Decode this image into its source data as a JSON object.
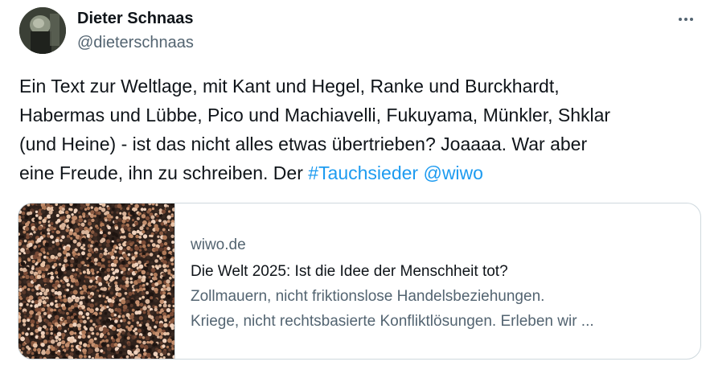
{
  "author": {
    "name": "Dieter Schnaas",
    "handle": "@dieterschnaas",
    "avatar_icon": "user-avatar"
  },
  "more_icon": "more-horizontal-icon",
  "tweet": {
    "line1": "Ein Text zur Weltlage, mit Kant und Hegel, Ranke und Burckhardt,",
    "line2": "Habermas und Lübbe, Pico und Machiavelli, Fukuyama, Münkler, Shklar",
    "line3": "(und Heine) - ist das nicht alles etwas übertrieben? Joaaaa. War aber",
    "line4_text": "eine Freude, ihn zu schreiben. Der ",
    "hashtag": "#Tauchsieder",
    "mention": "@wiwo"
  },
  "link_card": {
    "domain": "wiwo.de",
    "title": "Die Welt 2025: Ist die Idee der Menschheit tot?",
    "desc_line1": "Zollmauern, nicht friktionslose Handelsbeziehungen.",
    "desc_line2": "Kriege, nicht rechtsbasierte Konfliktlösungen. Erleben wir ...",
    "image_icon": "crowd-photo"
  },
  "colors": {
    "text": "#0f1419",
    "secondary": "#536471",
    "link": "#1d9bf0",
    "border": "#cfd9de"
  }
}
